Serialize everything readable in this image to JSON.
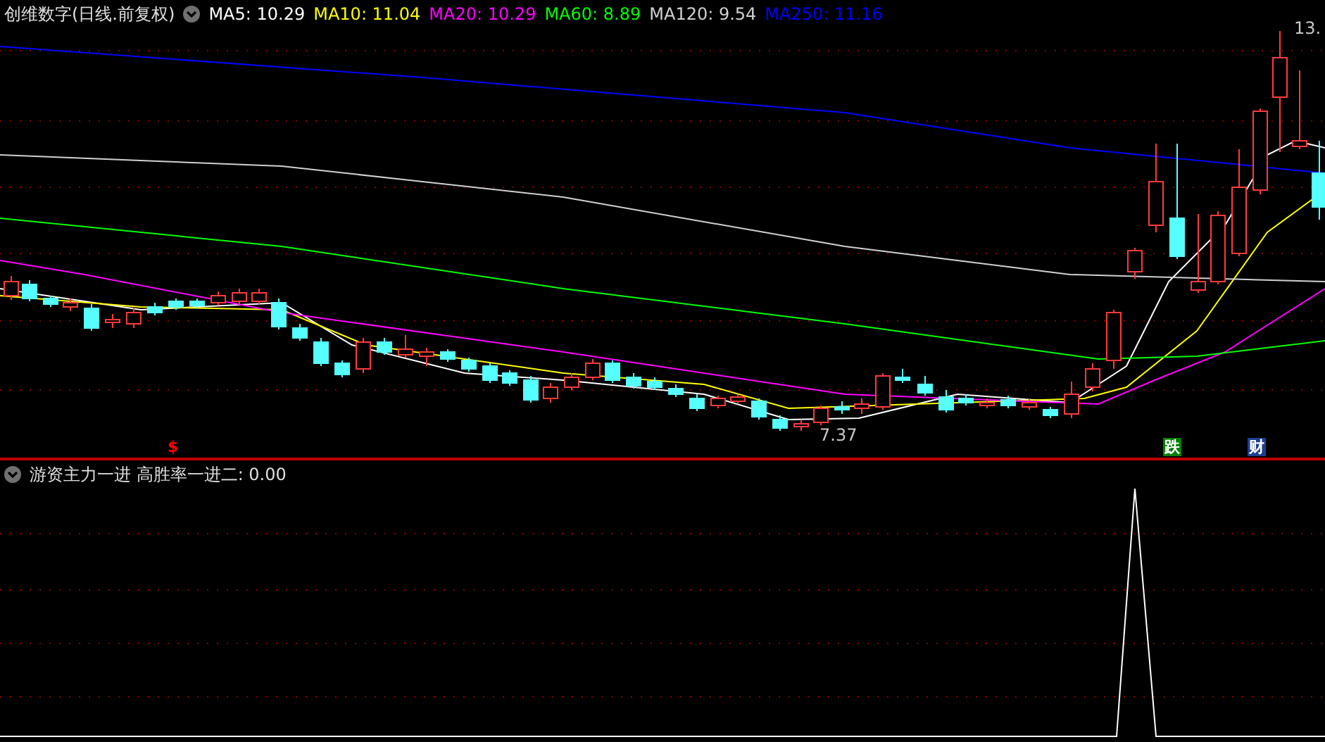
{
  "price_panel": {
    "title": "创维数字(日线.前复权)",
    "indicators": [
      {
        "label": "MA5: 10.29",
        "color": "#ffffff"
      },
      {
        "label": "MA10: 11.04",
        "color": "#ffff00"
      },
      {
        "label": "MA20: 10.29",
        "color": "#ff00ff"
      },
      {
        "label": "MA60: 8.89",
        "color": "#00ff00"
      },
      {
        "label": "MA120: 9.54",
        "color": "#d0d0d0"
      },
      {
        "label": "MA250: 11.16",
        "color": "#0000ff"
      }
    ],
    "high_label": "13.",
    "low_label": "7.37",
    "event_markers": [
      {
        "text": "$",
        "kind": "plain",
        "color": "#ff0000"
      },
      {
        "text": "跌",
        "kind": "badge",
        "color": "#008000"
      },
      {
        "text": "财",
        "kind": "badge",
        "color": "#1d3f8f"
      }
    ]
  },
  "indicator_panel": {
    "title": "游资主力一进 高胜率一进二: 0.00"
  }
}
